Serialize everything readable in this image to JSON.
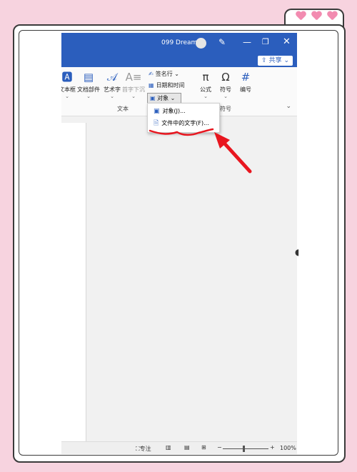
{
  "window": {
    "user_name": "099 Dream"
  },
  "ribbon": {
    "share_label": "共享",
    "text_group_label": "文本",
    "symbol_group_label": "符号",
    "buttons": {
      "textbox": "文本框",
      "quickparts": "文档部件",
      "wordart": "艺术字",
      "dropcap": "首字下沉",
      "signature": "签名行",
      "datetime": "日期和时间",
      "object": "对象",
      "equation": "公式",
      "symbol": "符号",
      "number": "编号"
    }
  },
  "dropdown": {
    "items": [
      "对象(J)...",
      "文件中的文字(F)..."
    ]
  },
  "status": {
    "focus_label": "专注",
    "zoom": "100%"
  },
  "colors": {
    "title_bar": "#2b5ebd",
    "annotation": "#e8161f",
    "background": "#f7d3df"
  }
}
